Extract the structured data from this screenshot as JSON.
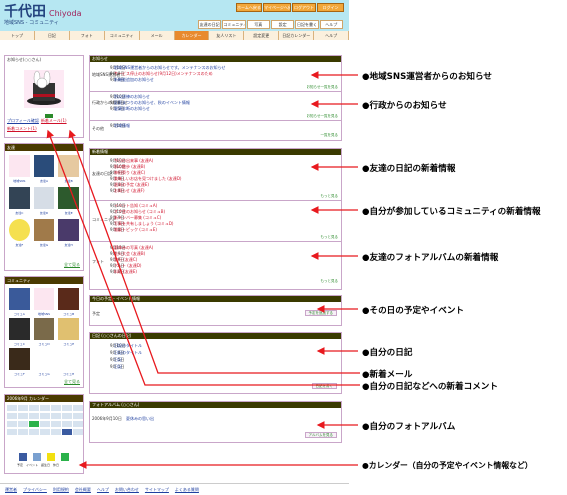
{
  "site": {
    "title": "千代田",
    "title_en": "Chiyoda",
    "subtitle": "地域SNS ‐ コミュニティ",
    "header_buttons": [
      "ホームへ戻る",
      "マイページへ戻る",
      "ログアウト",
      "ログイン"
    ],
    "header_menu": [
      "友達の日記",
      "コミュニティ",
      "写真",
      "設定",
      "日記を書く",
      "ヘルプ"
    ],
    "nav": [
      "トップ",
      "日記",
      "フォト",
      "コミュニティ",
      "メール",
      "カレンダー",
      "友人リスト",
      "設定変更",
      "日記カレンダー",
      "ヘルプ"
    ],
    "footer_links": [
      "運営者",
      "プライバシー",
      "利用規約",
      "会社概要",
      "ヘルプ",
      "お問い合わせ",
      "サイトマップ",
      "よくある質問"
    ]
  },
  "sidebar": {
    "profile_title": "お知らせ(○○さん)",
    "profile_links": [
      "プロフィール確認",
      "新着メール(1)",
      "新着コメント(1)"
    ],
    "friends_title": "友達",
    "friends": [
      "地域SNS",
      "友達A",
      "友達B",
      "友達C",
      "友達D",
      "友達E",
      "友達F",
      "友達G",
      "友達H"
    ],
    "friends_more": "全て見る",
    "community_title": "コミュニティ",
    "communities": [
      "地域SNS",
      "コミュA",
      "コミュB",
      "コミュC",
      "コミュD",
      "コミュE",
      "コミュF",
      "コミュG",
      "コミュH"
    ],
    "community_more": "全て見る",
    "calendar_title": "2006年9月 カレンダー",
    "calendar_legend": [
      "予定",
      "イベント",
      "誕生日",
      "休日"
    ]
  },
  "main": {
    "notice": {
      "title": "お知らせ",
      "admin_label": "地域SNS運営者",
      "admin_items": [
        {
          "date": "9月10日",
          "text": "地域SNS運営者からのお知らせです。メンテナンスのお知らせ"
        },
        {
          "date": "9月 9日",
          "text": "サービス停止のお知らせ(9月12日)メンテナンスのため",
          "red": true
        },
        {
          "date": "9月 8日",
          "text": "新機能追加のお知らせ"
        }
      ],
      "admin_more": "お知らせ一覧を見る",
      "gov_label": "行政からのお知らせ",
      "gov_items": [
        {
          "date": "9月10日",
          "text": "防災訓練のお知らせ"
        },
        {
          "date": "9月 8日",
          "text": "区民まつりのお知らせ、秋のイベント情報"
        },
        {
          "date": "9月 5日",
          "text": "健康診断のお知らせ"
        }
      ],
      "gov_more": "お知らせ一覧を見る",
      "misc_label": "その他",
      "misc_items": [
        {
          "date": "9月10日",
          "text": "地域情報"
        }
      ],
      "misc_more": "一覧を見る"
    },
    "news": {
      "title": "新着情報",
      "diary_label": "友達の日記",
      "diary_items": [
        {
          "date": "9月10日",
          "text": "今日の出来事 (友達A)"
        },
        {
          "date": "9月10日",
          "text": "秋の散歩 (友達B)"
        },
        {
          "date": "9月 9日",
          "text": "神田祭り (友達C)"
        },
        {
          "date": "9月 9日",
          "text": "美味しいお店を見つけました (友達D)"
        },
        {
          "date": "9月 8日",
          "text": "週末の予定 (友達E)"
        },
        {
          "date": "9月 8日",
          "text": "お知らせ (友達F)"
        }
      ],
      "diary_more": "もっと見る",
      "community_label": "コミュニティ",
      "community_items": [
        {
          "date": "9月10日",
          "text": "イベント告知 (コミュA)"
        },
        {
          "date": "9月10日",
          "text": "オフ会のお知らせ (コミュB)"
        },
        {
          "date": "9月 9日",
          "text": "新メンバー募集 (コミュC)"
        },
        {
          "date": "9月 9日",
          "text": "写真を共有しましょう (コミュD)"
        },
        {
          "date": "9月 8日",
          "text": "雑談トピック (コミュE)"
        }
      ],
      "community_more": "もっと見る",
      "photo_label": "フォト",
      "photo_items": [
        {
          "date": "9月10日",
          "text": "夏休みの写真 (友達A)"
        },
        {
          "date": "9月 9日",
          "text": "花火大会 (友達B)"
        },
        {
          "date": "9月 9日",
          "text": "旅行 (友達C)"
        },
        {
          "date": "9月 8日",
          "text": "ペット (友達D)"
        },
        {
          "date": "9月 8日",
          "text": "料理 (友達E)"
        }
      ],
      "photo_more": "もっと見る"
    },
    "schedule": {
      "title": "今日の予定・イベント情報",
      "label": "予定",
      "button": "予定を追加する"
    },
    "mydiary": {
      "title": "日記 (○○さんの日記)",
      "items": [
        {
          "date": "9月10日",
          "text": "日記のタイトル"
        },
        {
          "date": "9月 8日",
          "text": "日記のタイトル"
        },
        {
          "date": "9月 5日",
          "text": "日記"
        },
        {
          "date": "9月 1日",
          "text": "日記"
        }
      ],
      "button": "日記を書く"
    },
    "myphoto": {
      "title": "フォトアルバム (○○さん)",
      "item": {
        "date": "2006年9月10日",
        "text": "夏休みの思い出"
      },
      "button": "アルバムを見る"
    }
  },
  "callouts": [
    "●地域SNS運営者からのお知らせ",
    "●行政からのお知らせ",
    "●友達の日記の新着情報",
    "●自分が参加しているコミュニティの新着情報",
    "●友達のフォトアルバムの新着情報",
    "●その日の予定やイベント",
    "●自分の日記",
    "●新着メール",
    "●自分の日記などへの新着コメント",
    "●自分のフォトアルバム",
    "●カレンダー（自分の予定やイベント情報など）"
  ],
  "colors": {
    "header": "#b6e7f2",
    "accent": "#e88a2e",
    "panel_title": "#3a3a00",
    "panel_border": "#c9a6c9",
    "arrow": "#e8191e",
    "link": "#2040a0",
    "alert": "#d0102a"
  }
}
